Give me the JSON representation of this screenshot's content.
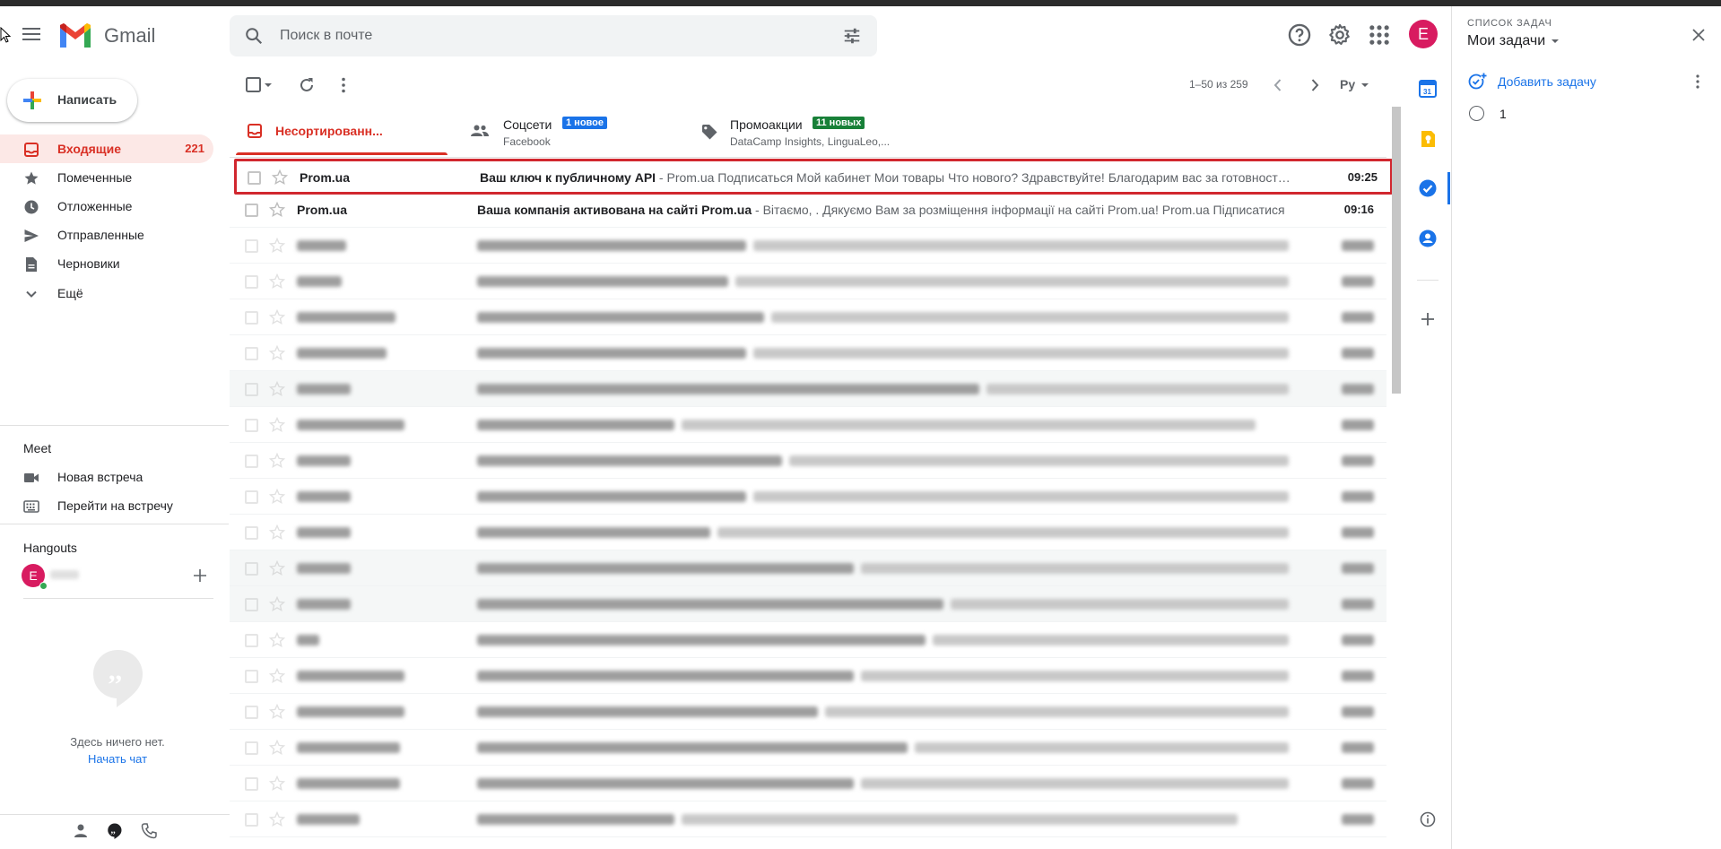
{
  "app": {
    "name": "Gmail"
  },
  "search": {
    "placeholder": "Поиск в почте"
  },
  "account": {
    "initial": "E"
  },
  "sidebar": {
    "compose_label": "Написать",
    "items": [
      {
        "label": "Входящие",
        "count": "221",
        "icon": "inbox-icon",
        "active": true
      },
      {
        "label": "Помеченные",
        "icon": "star-icon"
      },
      {
        "label": "Отложенные",
        "icon": "clock-icon"
      },
      {
        "label": "Отправленные",
        "icon": "send-icon"
      },
      {
        "label": "Черновики",
        "icon": "draft-icon"
      },
      {
        "label": "Ещё",
        "icon": "chevron-down-icon"
      }
    ],
    "meet": {
      "title": "Meet",
      "items": [
        {
          "label": "Новая встреча",
          "icon": "video-icon"
        },
        {
          "label": "Перейти на встречу",
          "icon": "keyboard-icon"
        }
      ]
    },
    "hangouts": {
      "title": "Hangouts",
      "user_initial": "E",
      "empty_text": "Здесь ничего нет.",
      "start_chat": "Начать чат"
    }
  },
  "toolbar": {
    "pager": "1–50 из 259",
    "lang": "Ру"
  },
  "tabs": [
    {
      "label": "Несортированн...",
      "active": true,
      "icon": "inbox-icon"
    },
    {
      "label": "Соцсети",
      "badge": "1 новое",
      "badge_color": "#1a73e8",
      "sub": "Facebook",
      "icon": "people-icon"
    },
    {
      "label": "Промоакции",
      "badge": "11 новых",
      "badge_color": "#188038",
      "sub": "DataCamp Insights, LinguaLeo,...",
      "icon": "tag-icon"
    }
  ],
  "emails": [
    {
      "sender": "Prom.ua",
      "subject": "Ваш ключ к публичному API",
      "snippet": " - Prom.ua Подписаться Мой кабинет Мои товары Что нового? Здравствуйте! Благодарим вас за готовность работать с нашим API",
      "time": "09:25",
      "highlighted": true
    },
    {
      "sender": "Prom.ua",
      "subject": "Ваша компанія активована на сайті Prom.ua",
      "snippet": " - Вітаємо, . Дякуємо Вам за розміщення інформації на сайті Prom.ua! Prom.ua Підписатися",
      "time": "09:16"
    }
  ],
  "tasks": {
    "caption": "СПИСОК ЗАДАЧ",
    "title": "Мои задачи",
    "add_label": "Добавить задачу",
    "items": [
      {
        "label": "1"
      }
    ]
  },
  "colors": {
    "accent": "#d93025",
    "link": "#1a73e8",
    "highlight_border": "#d1272f"
  }
}
